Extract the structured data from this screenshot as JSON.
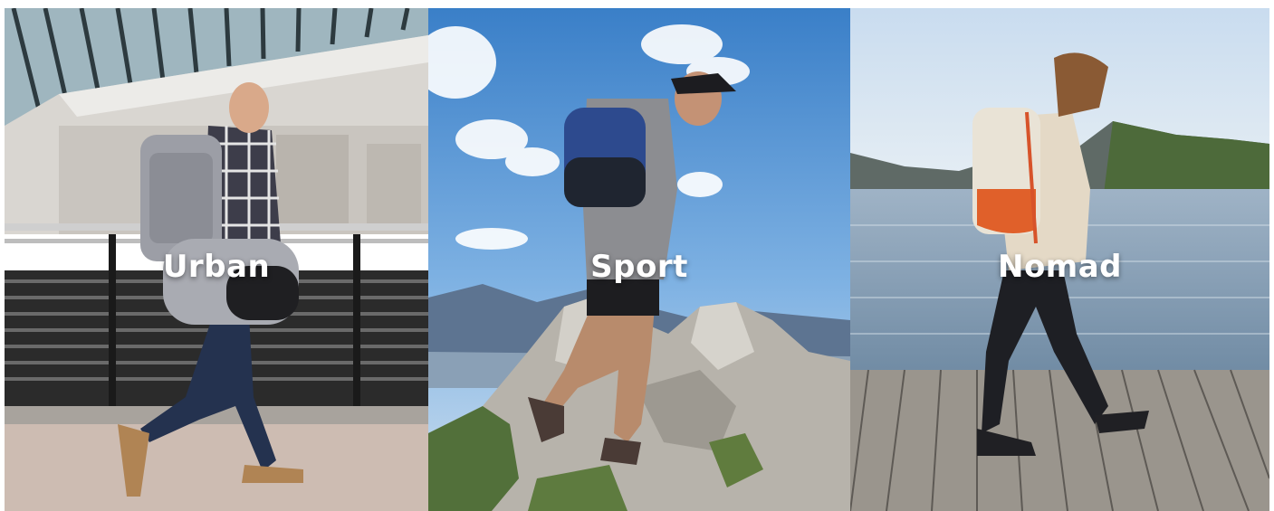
{
  "categories": [
    {
      "label": "Urban"
    },
    {
      "label": "Sport"
    },
    {
      "label": "Nomad"
    }
  ]
}
